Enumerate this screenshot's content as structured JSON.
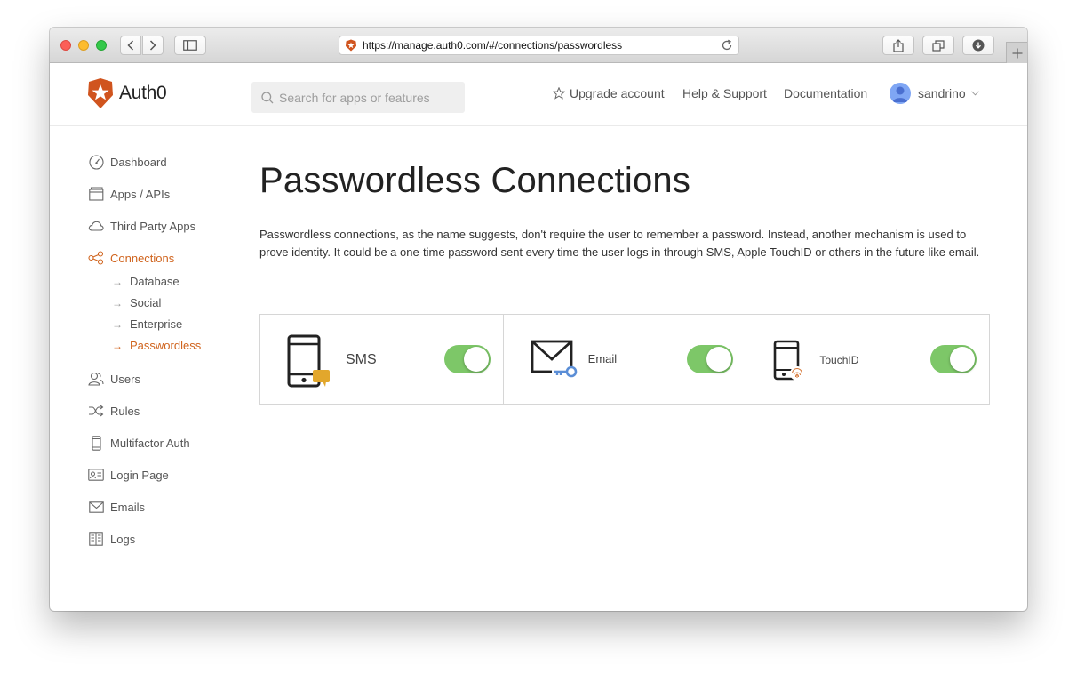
{
  "browser": {
    "url": "https://manage.auth0.com/#/connections/passwordless"
  },
  "header": {
    "logo_text": "Auth0",
    "search_placeholder": "Search for apps or features",
    "nav": {
      "upgrade": "Upgrade account",
      "help": "Help & Support",
      "docs": "Documentation",
      "user": "sandrino"
    }
  },
  "sidebar": {
    "items": [
      {
        "label": "Dashboard",
        "icon": "dashboard-icon"
      },
      {
        "label": "Apps / APIs",
        "icon": "apps-icon"
      },
      {
        "label": "Third Party Apps",
        "icon": "cloud-icon"
      },
      {
        "label": "Connections",
        "icon": "connections-icon",
        "active": true
      },
      {
        "label": "Users",
        "icon": "users-icon"
      },
      {
        "label": "Rules",
        "icon": "shuffle-icon"
      },
      {
        "label": "Multifactor Auth",
        "icon": "phone-icon"
      },
      {
        "label": "Login Page",
        "icon": "id-card-icon"
      },
      {
        "label": "Emails",
        "icon": "envelope-icon"
      },
      {
        "label": "Logs",
        "icon": "book-icon"
      }
    ],
    "connections_sub": [
      {
        "label": "Database"
      },
      {
        "label": "Social"
      },
      {
        "label": "Enterprise"
      },
      {
        "label": "Passwordless",
        "active": true
      }
    ]
  },
  "main": {
    "title": "Passwordless Connections",
    "description": "Passwordless connections, as the name suggests, don't require the user to remember a password. Instead, another mechanism is used to prove identity. It could be a one-time password sent every time the user logs in through SMS, Apple TouchID or others in the future like email.",
    "connections": [
      {
        "label": "SMS",
        "enabled": true,
        "icon": "sms-phone-icon"
      },
      {
        "label": "Email",
        "enabled": true,
        "icon": "email-key-icon"
      },
      {
        "label": "TouchID",
        "enabled": true,
        "icon": "touchid-phone-icon"
      }
    ]
  },
  "colors": {
    "accent": "#d0641e",
    "toggle_on": "#7dc768"
  }
}
